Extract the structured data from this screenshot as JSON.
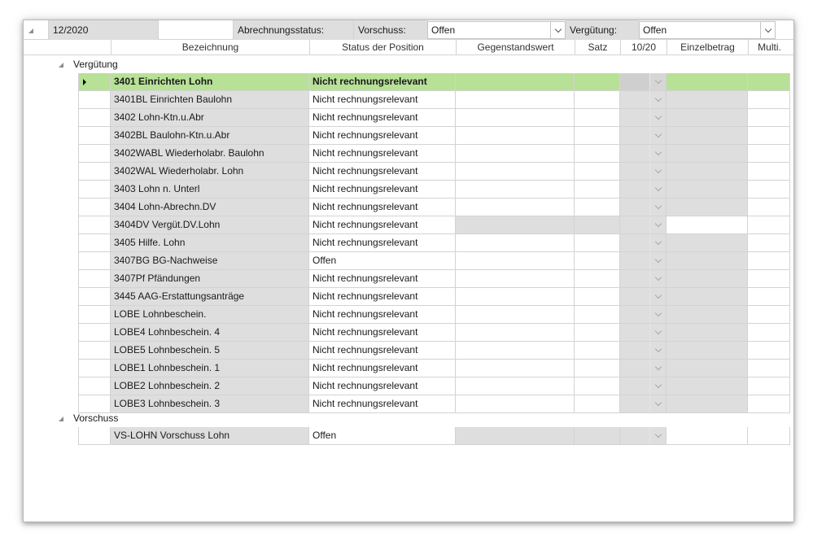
{
  "filter_bar": {
    "period": "12/2020",
    "abrechnungsstatus_label": "Abrechnungsstatus:",
    "vorschuss_label": "Vorschuss:",
    "vorschuss_value": "Offen",
    "verguetung_label": "Vergütung:",
    "verguetung_value": "Offen"
  },
  "columns": [
    "Bezeichnung",
    "Status der Position",
    "Gegenstandswert",
    "Satz",
    "10/20",
    "Einzelbetrag",
    "Multi."
  ],
  "groups": [
    {
      "label": "Vergütung",
      "rows": [
        {
          "bezeichnung": "3401 Einrichten Lohn",
          "status": "Nicht rechnungsrelevant"
        },
        {
          "bezeichnung": "3401BL Einrichten Baulohn",
          "status": "Nicht rechnungsrelevant"
        },
        {
          "bezeichnung": "3402 Lohn-Ktn.u.Abr",
          "status": "Nicht rechnungsrelevant"
        },
        {
          "bezeichnung": "3402BL Baulohn-Ktn.u.Abr",
          "status": "Nicht rechnungsrelevant"
        },
        {
          "bezeichnung": "3402WABL Wiederholabr. Baulohn",
          "status": "Nicht rechnungsrelevant"
        },
        {
          "bezeichnung": "3402WAL Wiederholabr. Lohn",
          "status": "Nicht rechnungsrelevant"
        },
        {
          "bezeichnung": "3403 Lohn n. Unterl",
          "status": "Nicht rechnungsrelevant"
        },
        {
          "bezeichnung": "3404 Lohn-Abrechn.DV",
          "status": "Nicht rechnungsrelevant"
        },
        {
          "bezeichnung": "3404DV Vergüt.DV.Lohn",
          "status": "Nicht rechnungsrelevant"
        },
        {
          "bezeichnung": "3405 Hilfe. Lohn",
          "status": "Nicht rechnungsrelevant"
        },
        {
          "bezeichnung": "3407BG BG-Nachweise",
          "status": "Offen"
        },
        {
          "bezeichnung": "3407Pf Pfändungen",
          "status": "Nicht rechnungsrelevant"
        },
        {
          "bezeichnung": "3445 AAG-Erstattungsanträge",
          "status": "Nicht rechnungsrelevant"
        },
        {
          "bezeichnung": "LOBE Lohnbeschein.",
          "status": "Nicht rechnungsrelevant"
        },
        {
          "bezeichnung": "LOBE4 Lohnbeschein. 4",
          "status": "Nicht rechnungsrelevant"
        },
        {
          "bezeichnung": "LOBE5 Lohnbeschein. 5",
          "status": "Nicht rechnungsrelevant"
        },
        {
          "bezeichnung": "LOBE1 Lohnbeschein. 1",
          "status": "Nicht rechnungsrelevant"
        },
        {
          "bezeichnung": "LOBE2 Lohnbeschein. 2",
          "status": "Nicht rechnungsrelevant"
        },
        {
          "bezeichnung": "LOBE3 Lohnbeschein. 3",
          "status": "Nicht rechnungsrelevant"
        }
      ]
    },
    {
      "label": "Vorschuss",
      "rows": [
        {
          "bezeichnung": "VS-LOHN Vorschuss Lohn",
          "status": "Offen"
        }
      ]
    }
  ],
  "selected_row": "3401 Einrichten Lohn",
  "colors": {
    "selected_row": "#b7e196",
    "readonly_cell": "#dedede",
    "grid_line": "#d3d3d3"
  },
  "icons": [
    "collapse-triangle-icon",
    "chevron-down-icon",
    "row-pointer-icon"
  ]
}
